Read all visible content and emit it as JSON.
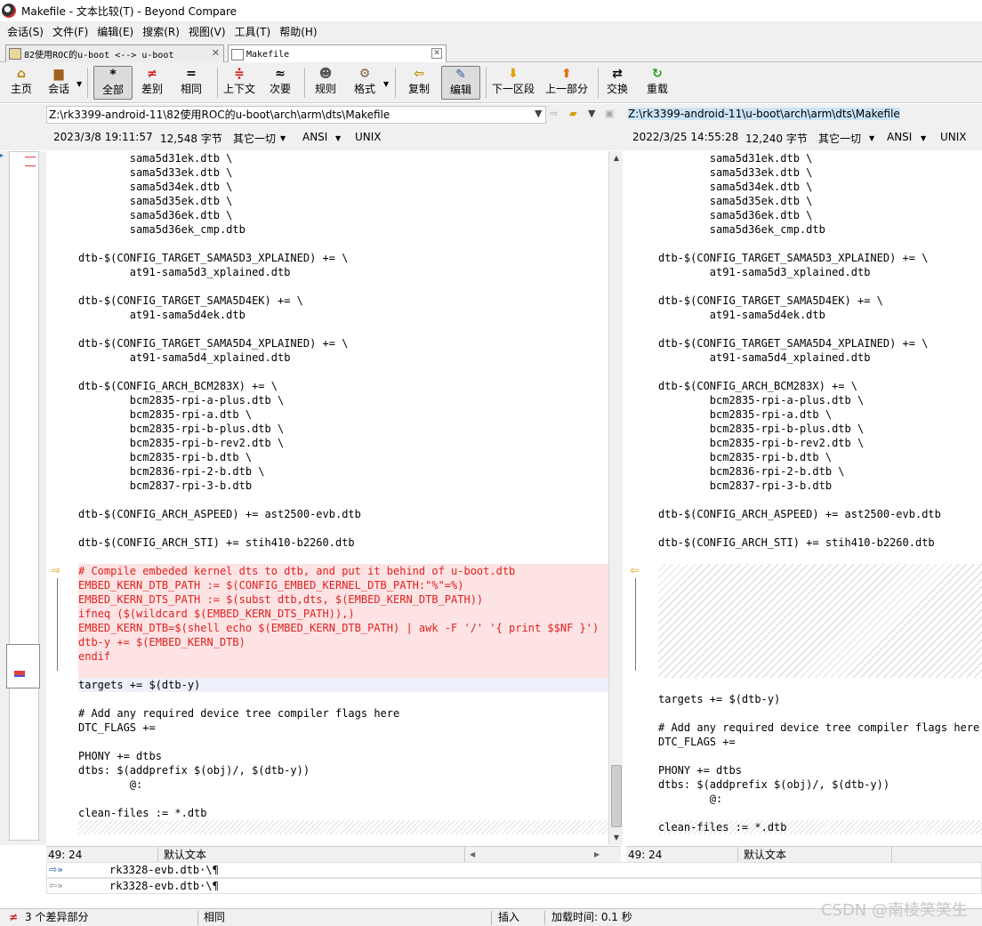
{
  "window": {
    "title": "Makefile - 文本比较(T) - Beyond Compare"
  },
  "menu": [
    "会话(S)",
    "文件(F)",
    "编辑(E)",
    "搜索(R)",
    "视图(V)",
    "工具(T)",
    "帮助(H)"
  ],
  "tabs": [
    {
      "label": "82使用ROC的u-boot <--> u-boot"
    },
    {
      "label": "Makefile"
    }
  ],
  "toolbar": {
    "home": "主页",
    "session": "会话",
    "all": "全部",
    "diffs": "差别",
    "same": "相同",
    "context": "上下文",
    "minor": "次要",
    "rules": "规则",
    "format": "格式",
    "copy": "复制",
    "edit": "编辑",
    "next_section": "下一区段",
    "prev_section": "上一部分",
    "swap": "交换",
    "reload": "重载"
  },
  "left": {
    "path": "Z:\\rk3399-android-11\\82使用ROC的u-boot\\arch\\arm\\dts\\Makefile",
    "date": "2023/3/8 19:11:57",
    "size": "12,548 字节",
    "misc": "其它一切",
    "encoding": "ANSI",
    "eol": "UNIX",
    "pos": "49: 24",
    "format": "默认文本"
  },
  "right": {
    "path": "Z:\\rk3399-android-11\\u-boot\\arch\\arm\\dts\\Makefile",
    "date": "2022/3/25 14:55:28",
    "size": "12,240 字节",
    "misc": "其它一切",
    "encoding": "ANSI",
    "eol": "UNIX",
    "pos": "49: 24",
    "format": "默认文本"
  },
  "code_top": [
    "\tsama5d31ek.dtb \\",
    "\tsama5d33ek.dtb \\",
    "\tsama5d34ek.dtb \\",
    "\tsama5d35ek.dtb \\",
    "\tsama5d36ek.dtb \\",
    "\tsama5d36ek_cmp.dtb",
    "",
    "dtb-$(CONFIG_TARGET_SAMA5D3_XPLAINED) += \\",
    "\tat91-sama5d3_xplained.dtb",
    "",
    "dtb-$(CONFIG_TARGET_SAMA5D4EK) += \\",
    "\tat91-sama5d4ek.dtb",
    "",
    "dtb-$(CONFIG_TARGET_SAMA5D4_XPLAINED) += \\",
    "\tat91-sama5d4_xplained.dtb",
    "",
    "dtb-$(CONFIG_ARCH_BCM283X) += \\",
    "\tbcm2835-rpi-a-plus.dtb \\",
    "\tbcm2835-rpi-a.dtb \\",
    "\tbcm2835-rpi-b-plus.dtb \\",
    "\tbcm2835-rpi-b-rev2.dtb \\",
    "\tbcm2835-rpi-b.dtb \\",
    "\tbcm2836-rpi-2-b.dtb \\",
    "\tbcm2837-rpi-3-b.dtb",
    "",
    "dtb-$(CONFIG_ARCH_ASPEED) += ast2500-evb.dtb",
    "",
    "dtb-$(CONFIG_ARCH_STI) += stih410-b2260.dtb",
    ""
  ],
  "code_diff": [
    "# Compile embeded kernel dts to dtb, and put it behind of u-boot.dtb",
    "EMBED_KERN_DTB_PATH := $(CONFIG_EMBED_KERNEL_DTB_PATH:\"%\"=%)",
    "EMBED_KERN_DTS_PATH := $(subst dtb,dts, $(EMBED_KERN_DTB_PATH))",
    "ifneq ($(wildcard $(EMBED_KERN_DTS_PATH)),)",
    "EMBED_KERN_DTB=$(shell echo $(EMBED_KERN_DTB_PATH) | awk -F '/' '{ print $$NF }')",
    "dtb-y += $(EMBED_KERN_DTB)",
    "endif",
    ""
  ],
  "code_bottom": [
    "",
    "targets += $(dtb-y)",
    "",
    "# Add any required device tree compiler flags here",
    "DTC_FLAGS +=",
    "",
    "PHONY += dtbs",
    "dtbs: $(addprefix $(obj)/, $(dtb-y))",
    "\t@:",
    "",
    "clean-files := *.dtb"
  ],
  "details": {
    "line1": "rk3328-evb.dtb·\\¶",
    "line2": "rk3328-evb.dtb·\\¶"
  },
  "status": {
    "diff_count": "3 个差异部分",
    "same": "相同",
    "insert": "插入",
    "load_time": "加载时间: 0.1 秒"
  },
  "watermark": "CSDN @南棱笑笑生",
  "colors": {
    "diff_text": "#e02020",
    "diff_bg": "#fde3e3",
    "selected_path": "#cce4f7"
  }
}
